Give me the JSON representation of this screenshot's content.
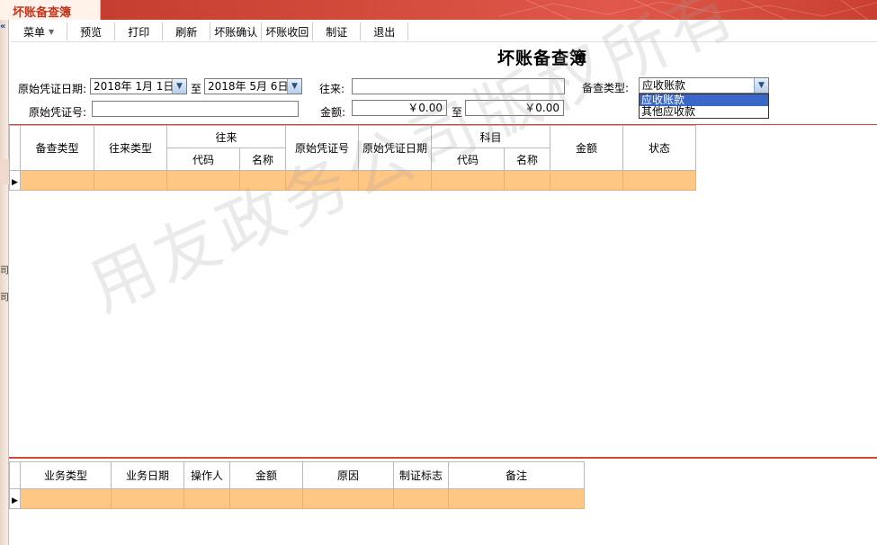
{
  "window": {
    "tab_title": "坏账备查簿"
  },
  "leftstrip": {
    "collapse_glyph": "«",
    "chars": [
      "司",
      "司"
    ]
  },
  "toolbar": {
    "items": [
      "菜单",
      "预览",
      "打印",
      "刷新",
      "坏账确认",
      "坏账收回",
      "制证",
      "退出"
    ]
  },
  "page": {
    "title": "坏账备查簿"
  },
  "filters": {
    "date_label": "原始凭证日期:",
    "date_from": "2018年 1月 1日",
    "to_label_1": "至",
    "date_to": "2018年 5月 6日",
    "counterparty_label": "往来:",
    "counterparty_value": "",
    "type_label": "备查类型:",
    "type_value": "应收账款",
    "voucher_label": "原始凭证号:",
    "voucher_value": "",
    "amount_label": "金额:",
    "amount_from": "￥0.00",
    "to_label_2": "至",
    "amount_to": "￥0.00",
    "type_options": [
      "应收账款",
      "其他应收款"
    ]
  },
  "main_grid": {
    "headers": {
      "col1": "备查类型",
      "col2": "往来类型",
      "group_wanglai": "往来",
      "wl_code": "代码",
      "wl_name": "名称",
      "col_voucher_no": "原始凭证号",
      "col_voucher_date": "原始凭证日期",
      "group_kemu": "科目",
      "km_code": "代码",
      "km_name": "名称",
      "col_amount": "金额",
      "col_status": "状态"
    }
  },
  "bottom_grid": {
    "headers": [
      "业务类型",
      "业务日期",
      "操作人",
      "金额",
      "原因",
      "制证标志",
      "备注"
    ]
  },
  "watermark": {
    "text": "用友政务公司版权所有"
  },
  "colors": {
    "title_bar": "#c0392b",
    "selected_row": "#ffc684",
    "panel_border": "#c94b3a",
    "dropdown_highlight": "#3b67c8"
  }
}
